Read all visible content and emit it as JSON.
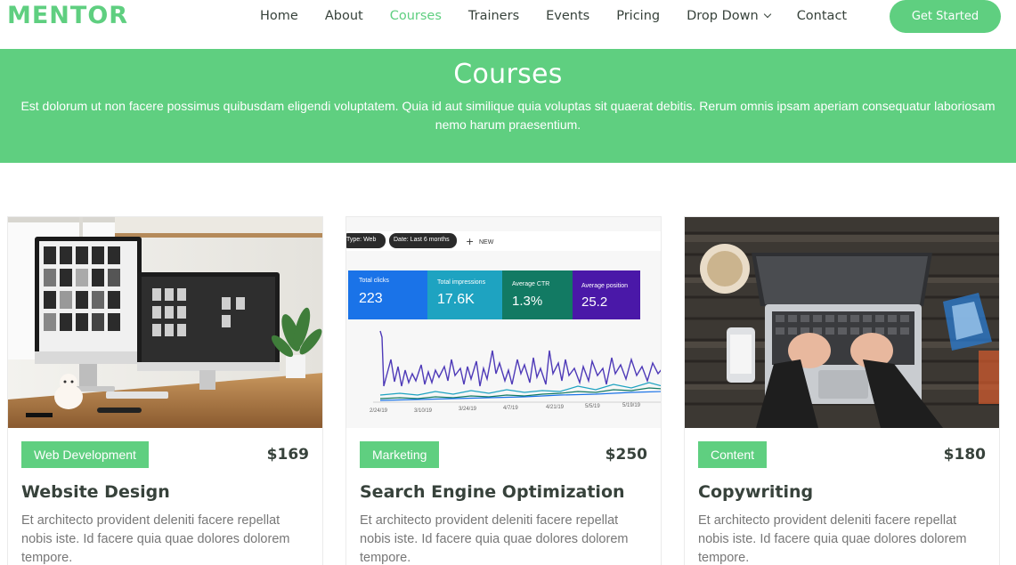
{
  "brand": "MENTOR",
  "nav": {
    "items": [
      "Home",
      "About",
      "Courses",
      "Trainers",
      "Events",
      "Pricing",
      "Drop Down",
      "Contact"
    ],
    "active": "Courses",
    "cta": "Get Started"
  },
  "banner": {
    "title": "Courses",
    "text": "Est dolorum ut non facere possimus quibusdam eligendi voluptatem. Quia id aut similique quia voluptas sit quaerat debitis. Rerum omnis ipsam aperiam consequatur laboriosam nemo harum praesentium."
  },
  "courses": [
    {
      "category": "Web Development",
      "price": "$169",
      "title": "Website Design",
      "description": "Et architecto provident deleniti facere repellat nobis iste. Id facere quia quae dolores dolorem tempore."
    },
    {
      "category": "Marketing",
      "price": "$250",
      "title": "Search Engine Optimization",
      "description": "Et architecto provident deleniti facere repellat nobis iste. Id facere quia quae dolores dolorem tempore.",
      "dashboard": {
        "filters": [
          "Type: Web",
          "Date: Last 6 months"
        ],
        "new_label": "NEW",
        "metrics": [
          {
            "label": "Total clicks",
            "value": "223"
          },
          {
            "label": "Total impressions",
            "value": "17.6K"
          },
          {
            "label": "Average CTR",
            "value": "1.3%"
          },
          {
            "label": "Average position",
            "value": "25.2"
          }
        ],
        "dates": [
          "2/24/19",
          "3/10/19",
          "3/24/19",
          "4/7/19",
          "4/21/19",
          "5/5/19",
          "5/19/19"
        ]
      }
    },
    {
      "category": "Content",
      "price": "$180",
      "title": "Copywriting",
      "description": "Et architecto provident deleniti facere repellat nobis iste. Id facere quia quae dolores dolorem tempore."
    }
  ],
  "colors": {
    "accent": "#5fcf80",
    "heading": "#37423b",
    "muted": "#777777",
    "metric_blue": "#1a73e8",
    "metric_cyan": "#1ea3c1",
    "metric_green": "#127a63",
    "metric_purple": "#4a18a8"
  }
}
